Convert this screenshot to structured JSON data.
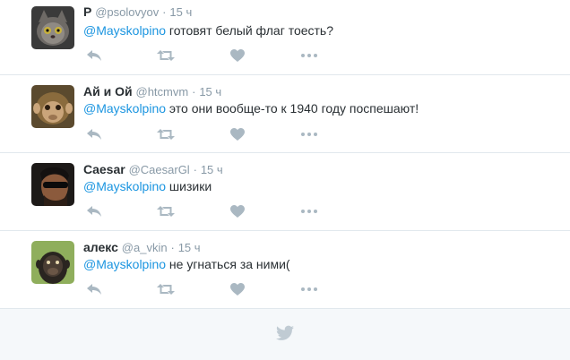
{
  "tweets": [
    {
      "fullname": "Р",
      "username": "@psolovyov",
      "separator": "·",
      "time": "15 ч",
      "mention": "@Mayskolpino",
      "text": " готовят белый флаг тоесть?"
    },
    {
      "fullname": "Ай и Ой",
      "username": "@htcmvm",
      "separator": "·",
      "time": "15 ч",
      "mention": "@Mayskolpino",
      "text": " это они вообще-то к 1940 году поспешают!"
    },
    {
      "fullname": "Caesar",
      "username": "@CaesarGl",
      "separator": "·",
      "time": "15 ч",
      "mention": "@Mayskolpino",
      "text": " шизики"
    },
    {
      "fullname": "алекс",
      "username": "@a_vkin",
      "separator": "·",
      "time": "15 ч",
      "mention": "@Mayskolpino",
      "text": " не угнаться за ними("
    }
  ],
  "colors": {
    "link": "#1b95e0",
    "muted": "#8899a6",
    "icon": "#aab8c2",
    "footer_bg": "#f5f8fa"
  },
  "icons": {
    "reply": "reply-icon",
    "retweet": "retweet-icon",
    "like": "heart-icon",
    "more": "more-dots-icon",
    "footer": "twitter-bird-icon"
  }
}
